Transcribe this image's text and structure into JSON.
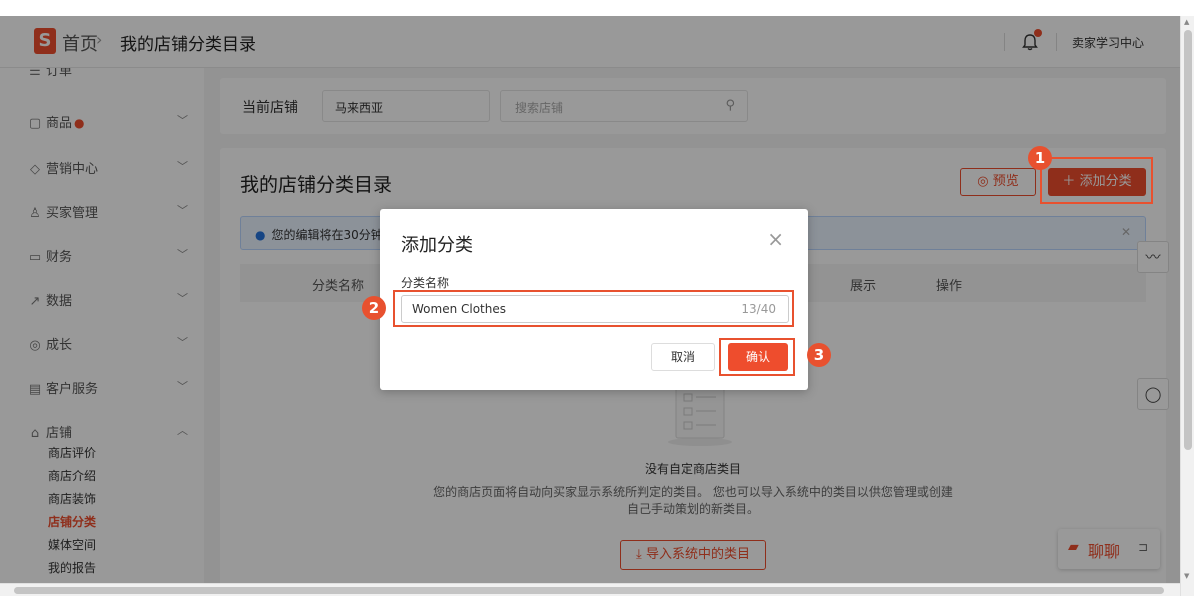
{
  "header": {
    "home": "首页",
    "separator": "›",
    "current": "我的店铺分类目录",
    "learning_center": "卖家学习中心"
  },
  "sidebar": {
    "items": [
      {
        "label": "订单",
        "icon": "order-icon"
      },
      {
        "label": "商品",
        "icon": "product-icon"
      },
      {
        "label": "营销中心",
        "icon": "tag-icon"
      },
      {
        "label": "买家管理",
        "icon": "buyer-icon"
      },
      {
        "label": "财务",
        "icon": "wallet-icon"
      },
      {
        "label": "数据",
        "icon": "chart-icon"
      },
      {
        "label": "成长",
        "icon": "growth-icon"
      },
      {
        "label": "客户服务",
        "icon": "service-icon"
      },
      {
        "label": "店铺",
        "icon": "shop-icon"
      }
    ],
    "shop_sub": [
      "商店评价",
      "商店介绍",
      "商店装饰",
      "店铺分类",
      "媒体空间",
      "我的报告"
    ],
    "product_dot": "●"
  },
  "shop_bar": {
    "label": "当前店铺",
    "value": "马来西亚",
    "search_placeholder": "搜索店铺"
  },
  "content": {
    "title": "我的店铺分类目录",
    "preview_label": "预览",
    "add_label": "添加分类",
    "info_text": "您的编辑将在30分钟",
    "col_name": "分类名称",
    "col_show": "展示",
    "col_action": "操作",
    "empty_title": "没有自定商店类目",
    "empty_desc_1": "您的商店页面将自动向买家显示系统所判定的类目。 您也可以导入系统中的类目以供您管理或创建",
    "empty_desc_2": "自己手动策划的新类目。",
    "import_label": "导入系统中的类目"
  },
  "modal": {
    "title": "添加分类",
    "field_label": "分类名称",
    "field_value": "Women Clothes",
    "counter": "13/40",
    "cancel": "取消",
    "confirm": "确认"
  },
  "chat": {
    "label": "聊聊"
  },
  "annotations": [
    "1",
    "2",
    "3"
  ],
  "colors": {
    "brand": "#ee4d2d",
    "highlight": "#e8512f",
    "info_bg": "#eaf3ff"
  }
}
